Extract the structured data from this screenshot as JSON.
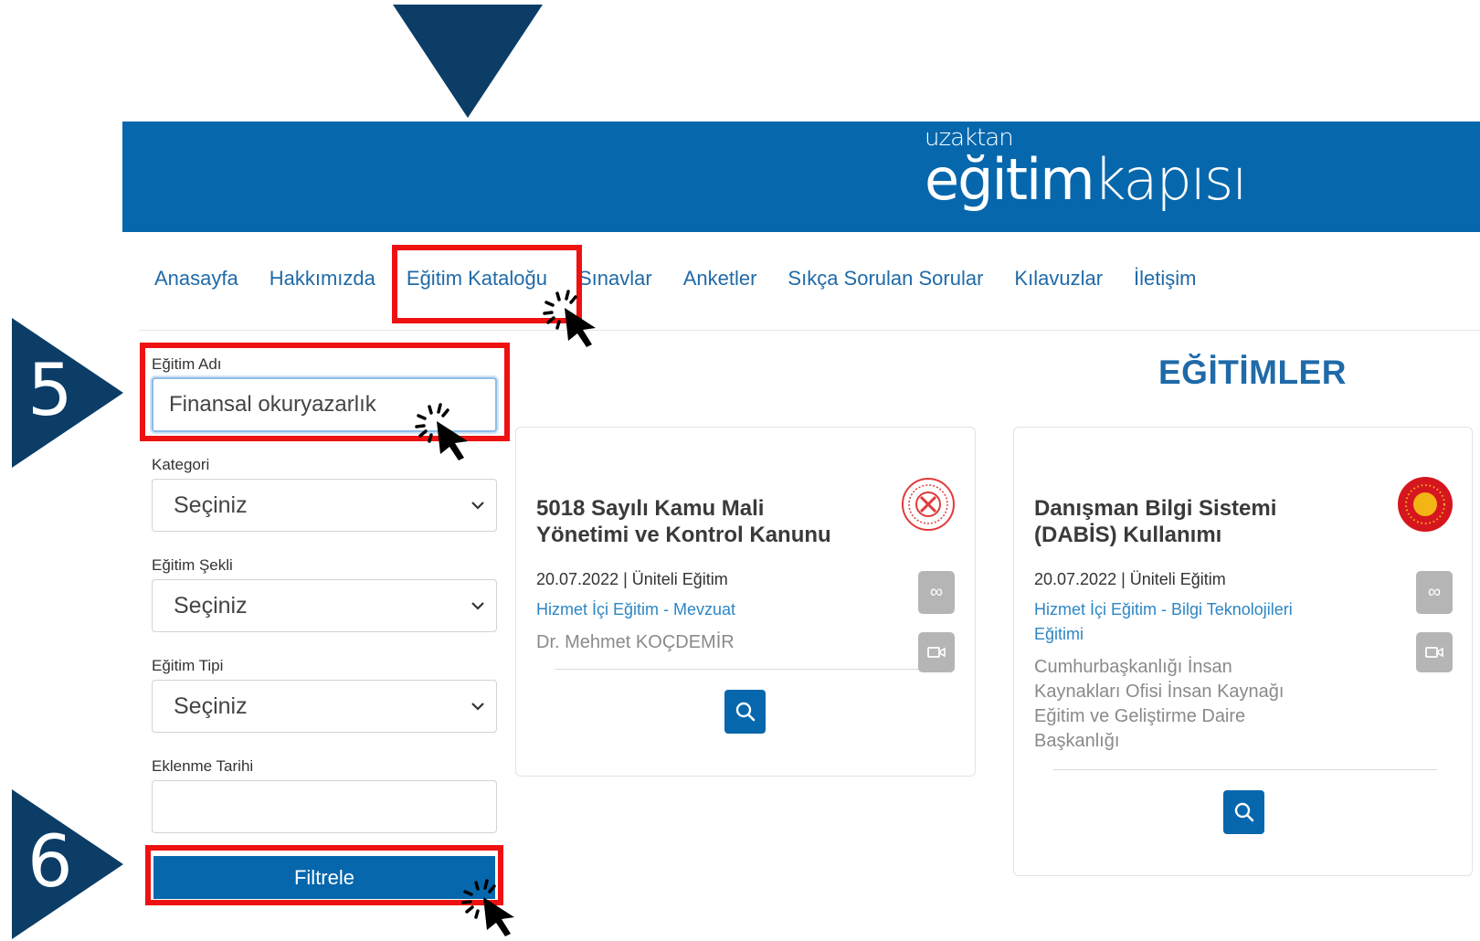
{
  "header": {
    "logo_small": "uzaktan",
    "logo_big_bold": "eğitim",
    "logo_big_thin": "kapısı"
  },
  "nav": {
    "items": [
      {
        "label": "Anasayfa"
      },
      {
        "label": "Hakkımızda"
      },
      {
        "label": "Eğitim Kataloğu"
      },
      {
        "label": "Sınavlar"
      },
      {
        "label": "Anketler"
      },
      {
        "label": "Sıkça Sorulan Sorular"
      },
      {
        "label": "Kılavuzlar"
      },
      {
        "label": "İletişim"
      }
    ]
  },
  "steps": {
    "step5": "5",
    "step6": "6"
  },
  "filters": {
    "name_label": "Eğitim Adı",
    "name_value": "Finansal okuryazarlık",
    "category_label": "Kategori",
    "category_value": "Seçiniz",
    "form_label": "Eğitim Şekli",
    "form_value": "Seçiniz",
    "type_label": "Eğitim Tipi",
    "type_value": "Seçiniz",
    "date_label": "Eklenme Tarihi",
    "date_value": "",
    "filter_button": "Filtrele"
  },
  "section_title": "EĞİTİMLER",
  "cards": [
    {
      "title_line1": "5018 Sayılı Kamu Mali",
      "title_line2": "Yönetimi ve Kontrol Kanunu",
      "meta": "20.07.2022 | Üniteli Eğitim",
      "category_line1": "Hizmet İçi Eğitim - Mevzuat",
      "author_line1": "Dr. Mehmet KOÇDEMİR"
    },
    {
      "title_line1": "Danışman Bilgi Sistemi",
      "title_line2": "(DABİS) Kullanımı",
      "meta": "20.07.2022 | Üniteli Eğitim",
      "category_line1": "Hizmet İçi Eğitim - Bilgi Teknolojileri",
      "category_line2": "Eğitimi",
      "author_line1": "Cumhurbaşkanlığı İnsan",
      "author_line2": "Kaynakları Ofisi İnsan Kaynağı",
      "author_line3": "Eğitim ve Geliştirme Daire",
      "author_line4": "Başkanlığı"
    }
  ],
  "icons": {
    "infinity": "∞",
    "colors": {
      "primary": "#0667ad",
      "dark": "#0b3d67",
      "highlight": "#ee1111",
      "grey_button": "#b5b5b5"
    }
  }
}
